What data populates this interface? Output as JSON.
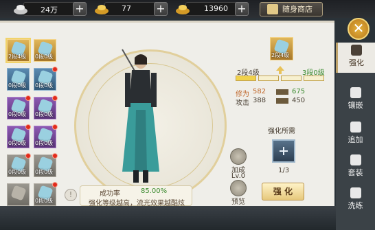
{
  "currency": {
    "silver": {
      "amount": "24万",
      "icon": "silver-ingot-icon"
    },
    "gold": {
      "amount": "77",
      "icon": "gold-ingot-icon"
    },
    "bound_gold": {
      "amount": "13960",
      "icon": "gold-ingot-icon"
    },
    "shop_label": "随身商店"
  },
  "tabs": [
    {
      "label": "强化",
      "active": true
    },
    {
      "label": "镶嵌",
      "active": false
    },
    {
      "label": "追加",
      "active": false
    },
    {
      "label": "套装",
      "active": false
    },
    {
      "label": "洗练",
      "active": false
    }
  ],
  "equipment": {
    "left_column": [
      {
        "level": "2段4级",
        "quality": "yellow",
        "selected": true,
        "red_dot": false
      },
      {
        "level": "0段0级",
        "quality": "blue",
        "selected": false,
        "red_dot": false
      },
      {
        "level": "0段0级",
        "quality": "purple",
        "selected": false,
        "red_dot": true
      },
      {
        "level": "0段0级",
        "quality": "purple",
        "selected": false,
        "red_dot": true
      },
      {
        "level": "0段0级",
        "quality": "gray",
        "selected": false,
        "red_dot": true
      },
      {
        "level": "",
        "quality": "gray",
        "selected": false,
        "red_dot": false
      }
    ],
    "right_column": [
      {
        "level": "0段0级",
        "quality": "yellow",
        "selected": false,
        "red_dot": false
      },
      {
        "level": "0段0级",
        "quality": "blue",
        "selected": false,
        "red_dot": true
      },
      {
        "level": "0段0级",
        "quality": "purple",
        "selected": false,
        "red_dot": true
      },
      {
        "level": "0段0级",
        "quality": "purple",
        "selected": false,
        "red_dot": true
      },
      {
        "level": "0段0级",
        "quality": "gray",
        "selected": false,
        "red_dot": true
      },
      {
        "level": "0段0级",
        "quality": "gray",
        "selected": false,
        "red_dot": true
      }
    ]
  },
  "preview": {
    "slot_level": "2段4级",
    "current_level": "2段4级",
    "next_level": "3段0级",
    "progress_filled": 1,
    "progress_total": 4
  },
  "stats": [
    {
      "name": "修为",
      "current": "582",
      "next": "675"
    },
    {
      "name": "攻击",
      "current": "388",
      "next": "450"
    }
  ],
  "tip": {
    "rate_label": "成功率",
    "rate_value": "85.00%",
    "text": "强化等级越高，流光效果越酷炫"
  },
  "side_buttons": {
    "bonus": {
      "label": "加成",
      "level": "Lv.0"
    },
    "preview": {
      "label": "预览"
    }
  },
  "requirement": {
    "label": "强化所需",
    "count": "1/3",
    "action": "强 化"
  },
  "colors": {
    "accent": "#e8c25a",
    "green": "#3a8a2e",
    "red": "#e22b1c"
  }
}
